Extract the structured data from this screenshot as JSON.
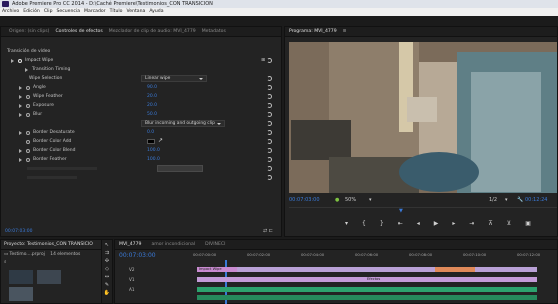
{
  "window": {
    "title": "Adobe Premiere Pro CC 2014 - D:\\Caché Premiere\\Testimonios_CON TRANSICION"
  },
  "menu": [
    "Archivo",
    "Edición",
    "Clip",
    "Secuencia",
    "Marcador",
    "Título",
    "Ventana",
    "Ayuda"
  ],
  "effect_panel": {
    "tabs": [
      "Origen: (sin clips)",
      "Controles de efectos",
      "Mezclador de clip de audio: MVI_4779",
      "Metadatos"
    ],
    "section_label": "Transición de vídeo",
    "effect_name": "Impact Wipe",
    "transition_timing": "Transition Timing",
    "wipe_selection_label": "Wipe Selection",
    "wipe_selection_value": "Linear wipe",
    "params": [
      {
        "label": "Angle",
        "value": "90.0"
      },
      {
        "label": "Wipe Feather",
        "value": "20.0"
      },
      {
        "label": "Exposure",
        "value": "20.0"
      },
      {
        "label": "Blur",
        "value": "50.0"
      }
    ],
    "blur_mode_value": "Blur incoming and outgoing clip",
    "params2": [
      {
        "label": "Border Desaturate",
        "value": "0.0"
      },
      {
        "label": "Border Color Add",
        "value": ""
      },
      {
        "label": "Border Color Blend",
        "value": "100.0"
      },
      {
        "label": "Border Feather",
        "value": "100.0"
      }
    ],
    "footer_time": "00:07:03:00"
  },
  "program_monitor": {
    "tab": "Programa: MVI_4779",
    "timecode": "00:07:03:00",
    "zoom": "50%",
    "resolution": "1/2",
    "end_time": "00:12:24"
  },
  "project_panel": {
    "title": "Proyecto: Testimonios_CON TRANSICIO",
    "file": "Testimo....prproj",
    "items_count": "14 elementos"
  },
  "timeline": {
    "tabs": [
      "MVI_4779",
      "amor incondicional",
      "DIVINECI"
    ],
    "timecode": "00:07:03:00",
    "ruler": [
      "00:07:00:00",
      "00:07:02:00",
      "00:07:04:00",
      "00:07:06:00",
      "00:07:08:00",
      "00:07:10:00",
      "00:07:12:00"
    ],
    "tracks": [
      "V2",
      "V1",
      "A1"
    ],
    "clip_label": "Impact Wipe",
    "audio_label": "Efectos"
  }
}
